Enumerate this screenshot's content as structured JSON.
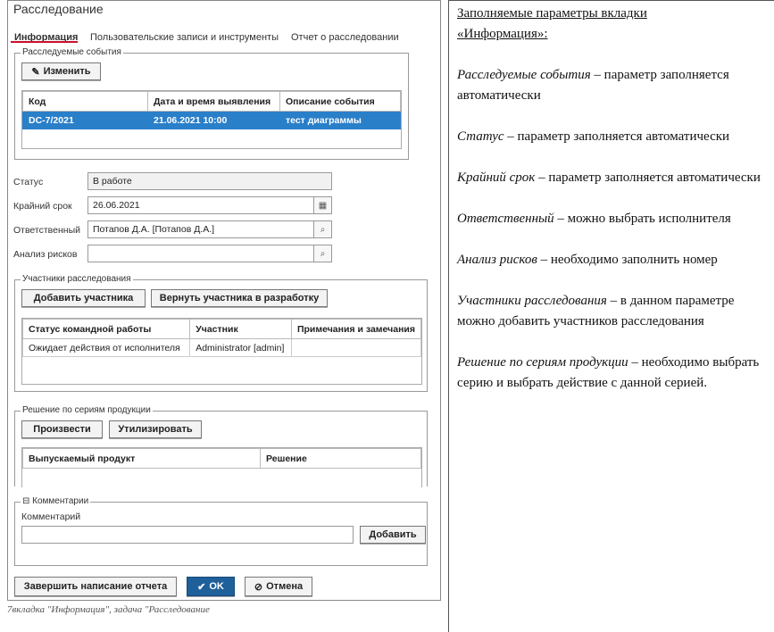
{
  "dialog": {
    "title": "Расследование",
    "tabs": [
      {
        "label": "Информация",
        "active": true
      },
      {
        "label": "Пользовательские записи и инструменты",
        "active": false
      },
      {
        "label": "Отчет о расследовании",
        "active": false
      }
    ],
    "events": {
      "legend": "Расследуемые события",
      "edit_button": "Изменить",
      "columns": [
        "Код",
        "Дата и время выявления",
        "Описание события"
      ],
      "rows": [
        {
          "code": "DC-7/2021",
          "datetime": "21.06.2021 10:00",
          "description": "тест диаграммы"
        }
      ]
    },
    "fields": {
      "status_label": "Статус",
      "status_value": "В работе",
      "deadline_label": "Крайний срок",
      "deadline_value": "26.06.2021",
      "responsible_label": "Ответственный",
      "responsible_value": "Потапов Д.А. [Потапов Д.А.]",
      "risk_label": "Анализ рисков",
      "risk_value": ""
    },
    "participants": {
      "legend": "Участники расследования",
      "add_button": "Добавить участника",
      "return_button": "Вернуть участника в разработку",
      "columns": [
        "Статус командной работы",
        "Участник",
        "Примечания и замечания"
      ],
      "rows": [
        {
          "status": "Ожидает действия от исполнителя",
          "participant": "Administrator [admin]",
          "notes": ""
        }
      ]
    },
    "decision": {
      "legend": "Решение по сериям продукции",
      "produce_button": "Произвести",
      "utilize_button": "Утилизировать",
      "columns": [
        "Выпускаемый продукт",
        "Решение"
      ]
    },
    "comments": {
      "legend": "Комментарии",
      "toggle": "⊟",
      "label": "Комментарий",
      "value": "",
      "add_button": "Добавить"
    },
    "footer": {
      "finish_button": "Завершить написание отчета",
      "ok_button": "OK",
      "cancel_button": "Отмена"
    }
  },
  "caption": "7вкладка \"Информация\", задача \"Расследование",
  "description": {
    "heading_line1": "Заполняемые параметры вкладки",
    "heading_line2": "«Информация»:",
    "items": [
      {
        "term": "Расследуемые события",
        "text": " – параметр заполняется автоматически"
      },
      {
        "term": "Статус",
        "text": " – параметр заполняется автоматически"
      },
      {
        "term": "Крайний срок",
        "text": " – параметр заполняется автоматически"
      },
      {
        "term": "Ответственный",
        "text": " – можно выбрать исполнителя"
      },
      {
        "term": "Анализ рисков",
        "text": " – необходимо заполнить номер"
      },
      {
        "term": "Участники расследования",
        "text": " – в данном параметре можно добавить участников расследования"
      },
      {
        "term": "Решение по сериям продукции",
        "text": " – необходимо выбрать серию и выбрать действие с данной серией."
      }
    ]
  },
  "colors": {
    "accent": "#1f5f9a",
    "selected_row": "#2a7fc9",
    "tab_underline": "#c8102e"
  }
}
